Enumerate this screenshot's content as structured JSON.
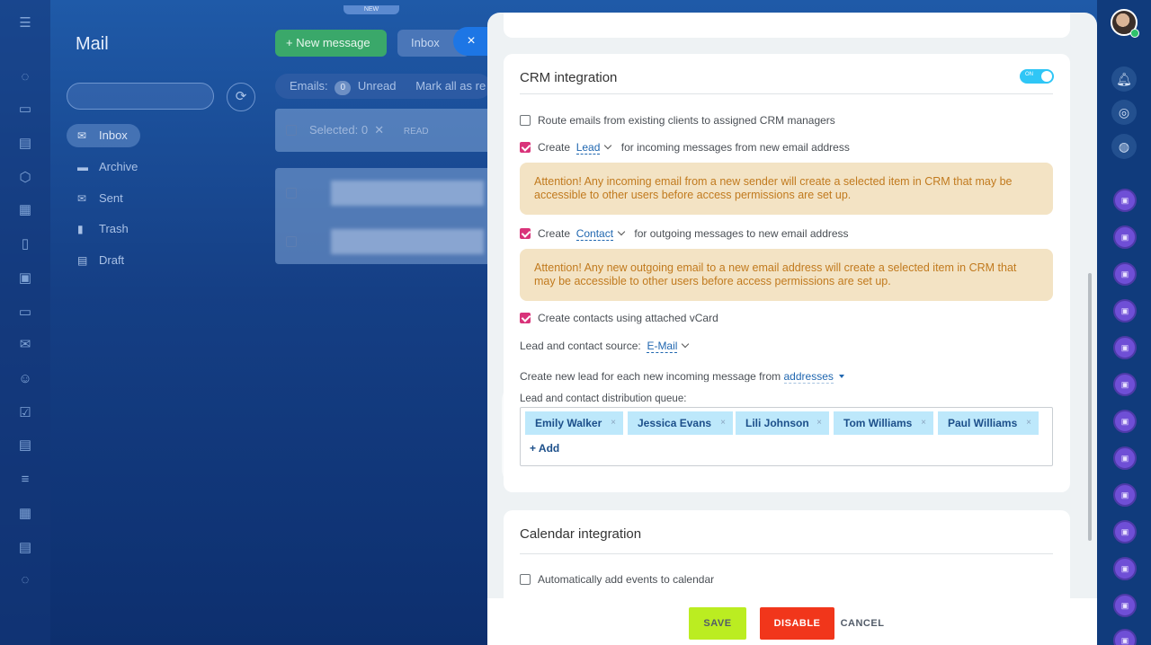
{
  "background": {
    "app_title": "Mail",
    "new_badge": "NEW",
    "new_message_label": "+ New message",
    "inbox_chip_label": "Inbox",
    "close_symbol": "×",
    "counters": {
      "emails_label": "Emails:",
      "unread_count": "0",
      "unread_label": "Unread",
      "mark_all_label": "Mark all as re"
    },
    "selection": {
      "selected_label": "Selected: 0",
      "read_label": "READ"
    },
    "folders": [
      {
        "label": "Inbox",
        "icon": "envelope-icon"
      },
      {
        "label": "Archive",
        "icon": "folder-icon"
      },
      {
        "label": "Sent",
        "icon": "sent-icon"
      },
      {
        "label": "Trash",
        "icon": "trash-icon"
      },
      {
        "label": "Draft",
        "icon": "draft-icon"
      }
    ]
  },
  "crm": {
    "title": "CRM integration",
    "toggle_label": "ON",
    "route_label": "Route emails from existing clients to assigned CRM managers",
    "create_label": "Create",
    "lead_entity": "Lead",
    "lead_suffix": "for incoming messages from new email address",
    "warning_incoming": "Attention! Any incoming email from a new sender will create a selected item in CRM that may be accessible to other users before access permissions are set up.",
    "contact_entity": "Contact",
    "contact_suffix": "for outgoing messages to new email address",
    "warning_outgoing": "Attention! Any new outgoing email to a new email address will create a selected item in CRM that may be accessible to other users before access permissions are set up.",
    "vcard_label": "Create contacts using attached vCard",
    "source_label": "Lead and contact source:",
    "source_value": "E-Mail",
    "new_lead_label": "Create new lead for each new incoming message from",
    "new_lead_value": "addresses",
    "queue_label": "Lead and contact distribution queue:",
    "queue": [
      "Emily Walker",
      "Jessica Evans",
      "Lili Johnson",
      "Tom Williams",
      "Paul Williams"
    ],
    "add_label": "+ Add",
    "remove_symbol": "×"
  },
  "calendar": {
    "title": "Calendar integration",
    "auto_add_label": "Automatically add events to calendar"
  },
  "footer": {
    "save": "SAVE",
    "disable": "DISABLE",
    "cancel": "CANCEL"
  },
  "colors": {
    "accent": "#2fc6f6",
    "checkbox": "#d9337a",
    "save": "#bbed21",
    "disable": "#f1361b",
    "warning_bg": "#f3e3c4"
  }
}
